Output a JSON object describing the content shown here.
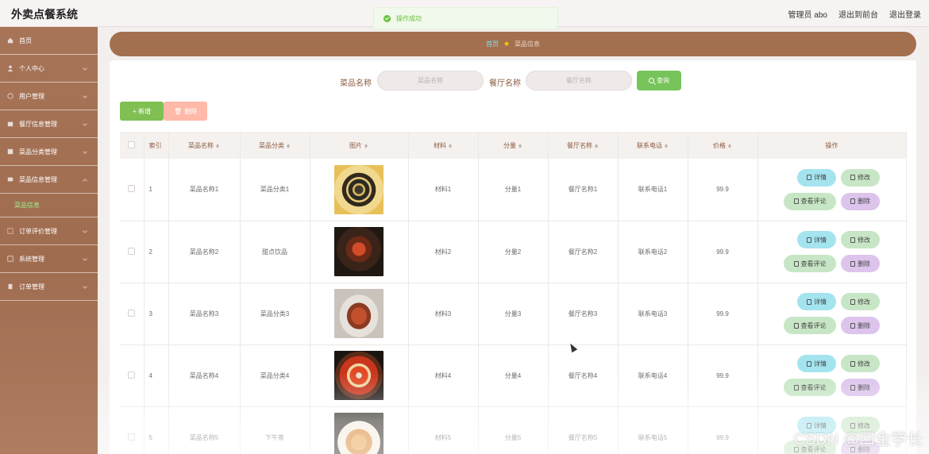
{
  "app": {
    "title": "外卖点餐系统"
  },
  "toast": {
    "message": "操作成功"
  },
  "top_links": {
    "admin_label": "管理员 abo",
    "back_to_front": "退出到前台",
    "logout": "退出登录"
  },
  "sidebar": {
    "items": [
      {
        "label": "首页"
      },
      {
        "label": "个人中心"
      },
      {
        "label": "用户管理"
      },
      {
        "label": "餐厅信息管理"
      },
      {
        "label": "菜品分类管理"
      },
      {
        "label": "菜品信息管理"
      },
      {
        "label": "订单评价管理"
      },
      {
        "label": "系统管理"
      },
      {
        "label": "订单管理"
      }
    ],
    "submenu_label": "菜品信息"
  },
  "breadcrumb": {
    "home": "首页",
    "current": "菜品信息"
  },
  "search": {
    "dish_label": "菜品名称",
    "dish_placeholder": "菜品名称",
    "restaurant_label": "餐厅名称",
    "restaurant_placeholder": "餐厅名称",
    "query_button": "查询"
  },
  "actions": {
    "add": "+ 新增",
    "delete": "删除"
  },
  "table": {
    "headers": [
      "索引",
      "菜品名称",
      "菜品分类",
      "图片",
      "材料",
      "分量",
      "餐厅名称",
      "联系电话",
      "价格",
      "操作"
    ],
    "rows": [
      {
        "index": "1",
        "name": "菜品名称1",
        "category": "菜品分类1",
        "material": "材料1",
        "portion": "分量1",
        "restaurant": "餐厅名称1",
        "phone": "联系电话1",
        "price": "99.9"
      },
      {
        "index": "2",
        "name": "菜品名称2",
        "category": "甜点饮品",
        "material": "材料2",
        "portion": "分量2",
        "restaurant": "餐厅名称2",
        "phone": "联系电话2",
        "price": "99.9"
      },
      {
        "index": "3",
        "name": "菜品名称3",
        "category": "菜品分类3",
        "material": "材料3",
        "portion": "分量3",
        "restaurant": "餐厅名称3",
        "phone": "联系电话3",
        "price": "99.9"
      },
      {
        "index": "4",
        "name": "菜品名称4",
        "category": "菜品分类4",
        "material": "材料4",
        "portion": "分量4",
        "restaurant": "餐厅名称4",
        "phone": "联系电话4",
        "price": "99.9"
      },
      {
        "index": "5",
        "name": "菜品名称5",
        "category": "下午茶",
        "material": "材料5",
        "portion": "分量5",
        "restaurant": "餐厅名称5",
        "phone": "联系电话5",
        "price": "99.9"
      }
    ],
    "op_labels": {
      "detail": "详情",
      "edit": "修改",
      "review": "查看评论",
      "delete": "删除"
    }
  },
  "watermark": "CSDN @四金学长",
  "colors": {
    "sidebar": "#a87458",
    "accent_green": "#77c45b",
    "delete_pink": "#ffb9a8",
    "detail_cyan": "#a3e4ef"
  }
}
